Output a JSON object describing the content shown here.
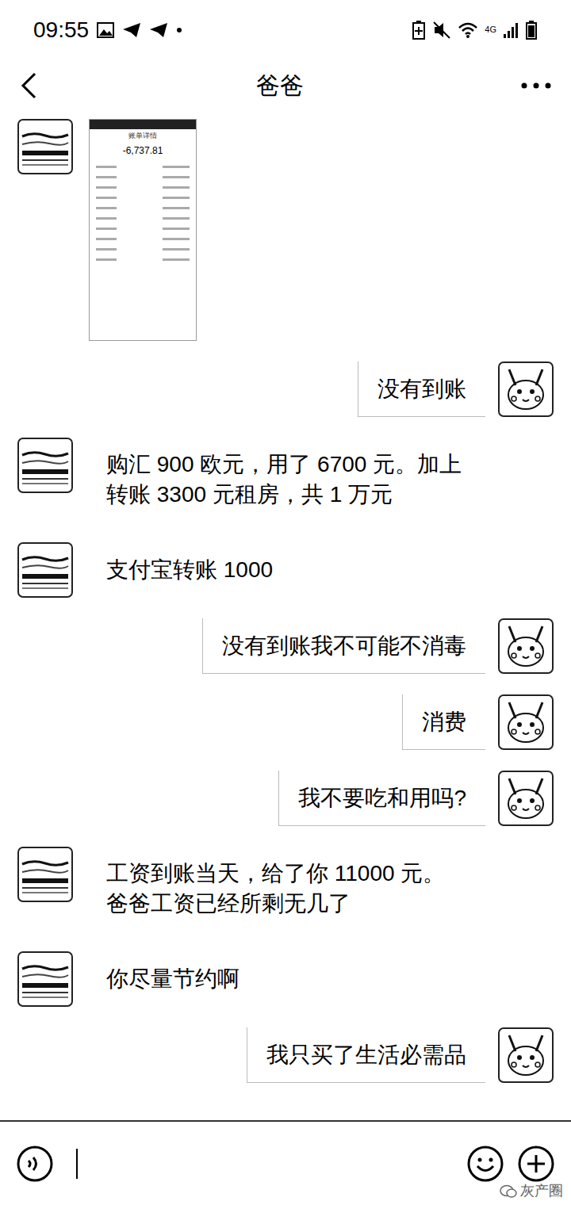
{
  "status_bar": {
    "time": "09:55",
    "network": "4G"
  },
  "header": {
    "title": "爸爸"
  },
  "messages": [
    {
      "from": "other",
      "kind": "image",
      "image": {
        "title": "账单详情",
        "amount": "-6,737.81"
      }
    },
    {
      "from": "me",
      "kind": "text",
      "lines": [
        "没有到账"
      ]
    },
    {
      "from": "other",
      "kind": "text",
      "lines": [
        "购汇 900 欧元，用了 6700 元。加上",
        "转账 3300 元租房，共 1 万元"
      ]
    },
    {
      "from": "other",
      "kind": "text",
      "lines": [
        "支付宝转账 1000"
      ]
    },
    {
      "from": "me",
      "kind": "text",
      "lines": [
        "没有到账我不可能不消毒"
      ]
    },
    {
      "from": "me",
      "kind": "text",
      "lines": [
        "消费"
      ]
    },
    {
      "from": "me",
      "kind": "text",
      "lines": [
        "我不要吃和用吗?"
      ]
    },
    {
      "from": "other",
      "kind": "text",
      "lines": [
        "工资到账当天，给了你 11000 元。",
        "爸爸工资已经所剩无几了"
      ]
    },
    {
      "from": "other",
      "kind": "text",
      "lines": [
        "你尽量节约啊"
      ]
    },
    {
      "from": "me",
      "kind": "text",
      "lines": [
        "我只买了生活必需品"
      ]
    }
  ],
  "watermark": "灰产圈"
}
